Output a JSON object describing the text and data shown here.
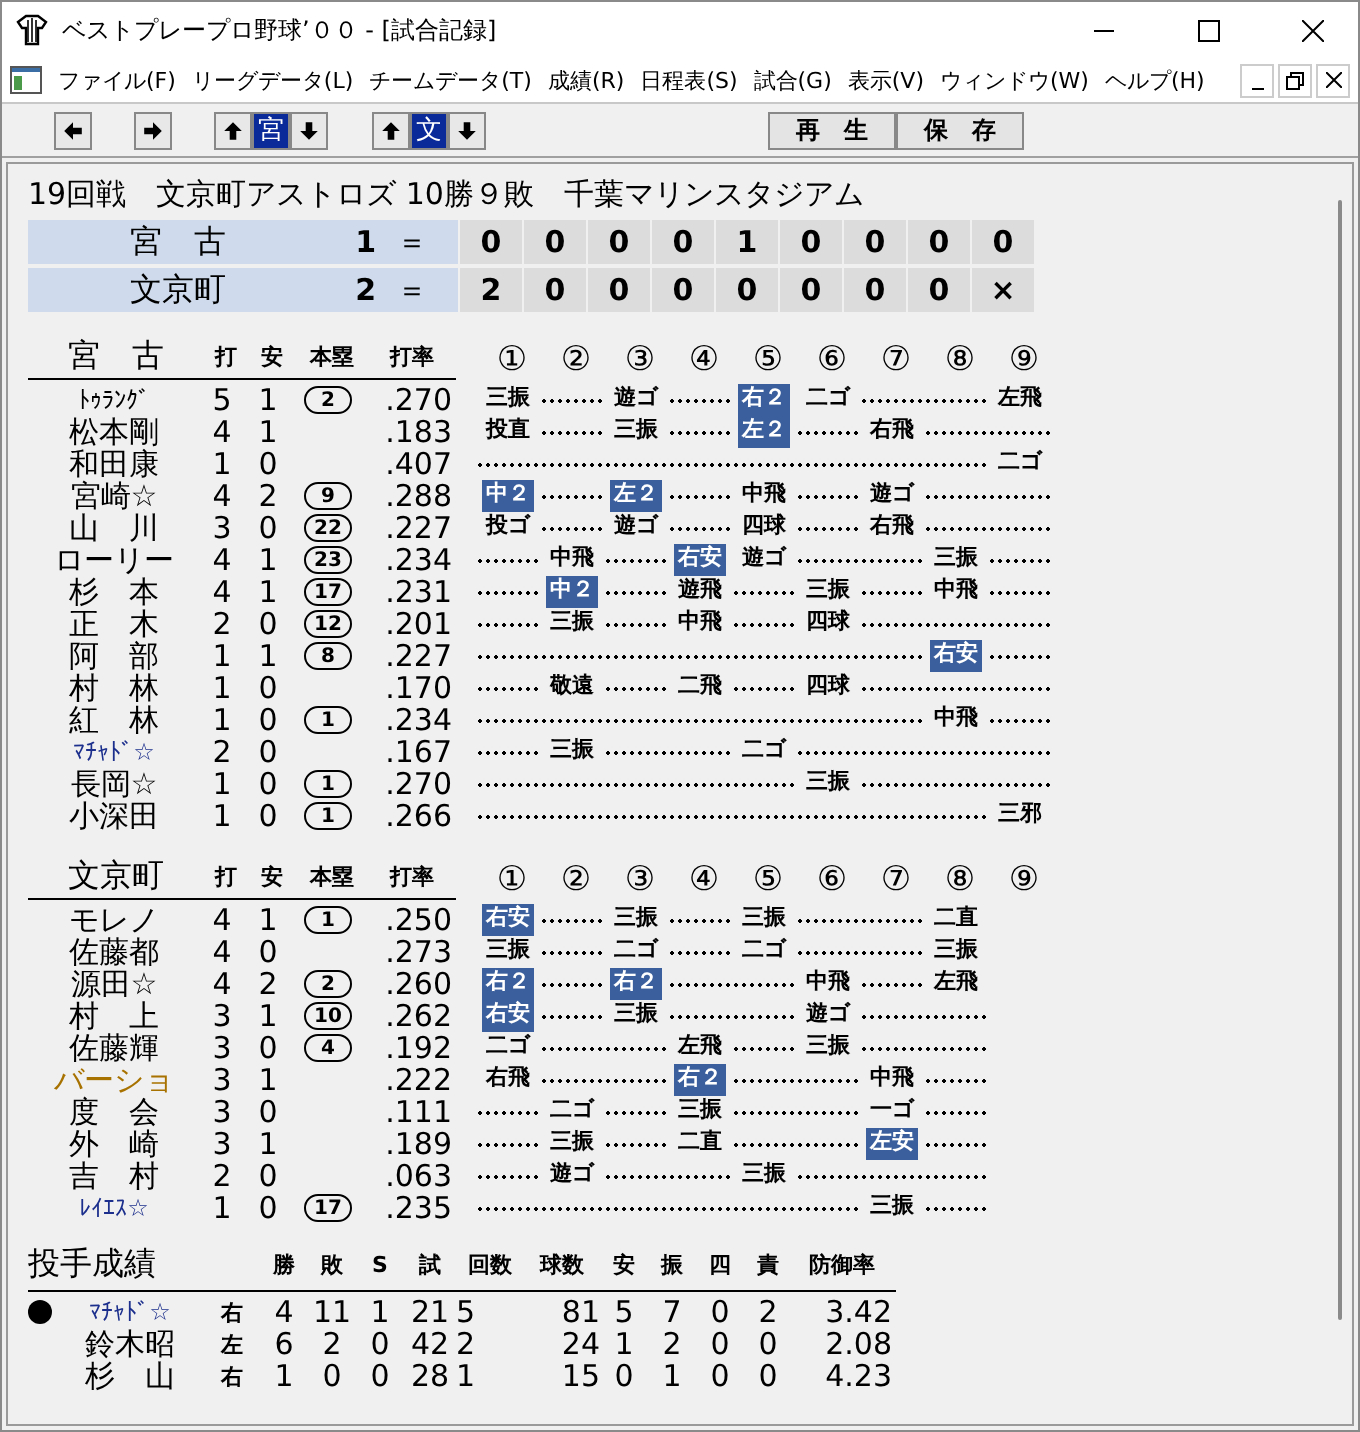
{
  "window": {
    "title": "ベストプレープロ野球’００ - [試合記録]"
  },
  "menu": [
    "ファイル(F)",
    "リーグデータ(L)",
    "チームデータ(T)",
    "成績(R)",
    "日程表(S)",
    "試合(G)",
    "表示(V)",
    "ウィンドウ(W)",
    "ヘルプ(H)"
  ],
  "toolbar": {
    "team_buttons": [
      {
        "label": "宮",
        "selected": true
      },
      {
        "label": "文",
        "selected": true
      }
    ],
    "actions": [
      "再　生",
      "保　存"
    ]
  },
  "game_info": "19回戦　文京町アストロズ 10勝９敗　千葉マリンスタジアム",
  "scoreboard": [
    {
      "team": "宮　古",
      "total": "1",
      "separator": "＝",
      "innings": [
        "0",
        "0",
        "0",
        "0",
        "1",
        "0",
        "0",
        "0",
        "0"
      ]
    },
    {
      "team": "文京町",
      "total": "2",
      "separator": "＝",
      "innings": [
        "2",
        "0",
        "0",
        "0",
        "0",
        "0",
        "0",
        "0",
        "×"
      ]
    }
  ],
  "batting": [
    {
      "team": "宮　古",
      "columns": [
        "打",
        "安",
        "本塁",
        "打率"
      ],
      "innings_headers": [
        "①",
        "②",
        "③",
        "④",
        "⑤",
        "⑥",
        "⑦",
        "⑧",
        "⑨"
      ],
      "rows": [
        {
          "name": "ﾄｩﾗﾝｸﾞ",
          "color": "#000000",
          "at_bats": "5",
          "hits": "1",
          "home_runs": "2",
          "average": ".270",
          "innings": [
            {
              "kind": "play",
              "result": "三振",
              "hit": false
            },
            {
              "kind": "empty"
            },
            {
              "kind": "play",
              "result": "遊ゴ",
              "hit": false
            },
            {
              "kind": "empty"
            },
            {
              "kind": "play",
              "result": "右２",
              "hit": true
            },
            {
              "kind": "play",
              "result": "二ゴ",
              "hit": false
            },
            {
              "kind": "empty"
            },
            {
              "kind": "empty"
            },
            {
              "kind": "play",
              "result": "左飛",
              "hit": false
            }
          ]
        },
        {
          "name": "松本剛",
          "color": "#000000",
          "at_bats": "4",
          "hits": "1",
          "average": ".183",
          "innings": [
            {
              "kind": "play",
              "result": "投直",
              "hit": false
            },
            {
              "kind": "empty"
            },
            {
              "kind": "play",
              "result": "三振",
              "hit": false
            },
            {
              "kind": "empty"
            },
            {
              "kind": "play",
              "result": "左２",
              "hit": true
            },
            {
              "kind": "empty"
            },
            {
              "kind": "play",
              "result": "右飛",
              "hit": false
            },
            {
              "kind": "empty"
            },
            {
              "kind": "empty"
            }
          ]
        },
        {
          "name": "和田康",
          "color": "#000000",
          "at_bats": "1",
          "hits": "0",
          "average": ".407",
          "innings": [
            {
              "kind": "empty"
            },
            {
              "kind": "empty"
            },
            {
              "kind": "empty"
            },
            {
              "kind": "empty"
            },
            {
              "kind": "empty"
            },
            {
              "kind": "empty"
            },
            {
              "kind": "empty"
            },
            {
              "kind": "empty"
            },
            {
              "kind": "play",
              "result": "二ゴ",
              "hit": false
            }
          ]
        },
        {
          "name": "宮崎☆",
          "color": "#000000",
          "at_bats": "4",
          "hits": "2",
          "home_runs": "9",
          "average": ".288",
          "innings": [
            {
              "kind": "play",
              "result": "中２",
              "hit": true
            },
            {
              "kind": "empty"
            },
            {
              "kind": "play",
              "result": "左２",
              "hit": true
            },
            {
              "kind": "empty"
            },
            {
              "kind": "play",
              "result": "中飛",
              "hit": false
            },
            {
              "kind": "empty"
            },
            {
              "kind": "play",
              "result": "遊ゴ",
              "hit": false
            },
            {
              "kind": "empty"
            },
            {
              "kind": "empty"
            }
          ]
        },
        {
          "name": "山　川",
          "color": "#000000",
          "at_bats": "3",
          "hits": "0",
          "home_runs": "22",
          "average": ".227",
          "innings": [
            {
              "kind": "play",
              "result": "投ゴ",
              "hit": false
            },
            {
              "kind": "empty"
            },
            {
              "kind": "play",
              "result": "遊ゴ",
              "hit": false
            },
            {
              "kind": "empty"
            },
            {
              "kind": "play",
              "result": "四球",
              "hit": false
            },
            {
              "kind": "empty"
            },
            {
              "kind": "play",
              "result": "右飛",
              "hit": false
            },
            {
              "kind": "empty"
            },
            {
              "kind": "empty"
            }
          ]
        },
        {
          "name": "ローリー",
          "color": "#000000",
          "at_bats": "4",
          "hits": "1",
          "home_runs": "23",
          "average": ".234",
          "innings": [
            {
              "kind": "empty"
            },
            {
              "kind": "play",
              "result": "中飛",
              "hit": false
            },
            {
              "kind": "empty"
            },
            {
              "kind": "play",
              "result": "右安",
              "hit": true
            },
            {
              "kind": "play",
              "result": "遊ゴ",
              "hit": false
            },
            {
              "kind": "empty"
            },
            {
              "kind": "empty"
            },
            {
              "kind": "play",
              "result": "三振",
              "hit": false
            },
            {
              "kind": "empty"
            }
          ]
        },
        {
          "name": "杉　本",
          "color": "#000000",
          "at_bats": "4",
          "hits": "1",
          "home_runs": "17",
          "average": ".231",
          "innings": [
            {
              "kind": "empty"
            },
            {
              "kind": "play",
              "result": "中２",
              "hit": true
            },
            {
              "kind": "empty"
            },
            {
              "kind": "play",
              "result": "遊飛",
              "hit": false
            },
            {
              "kind": "empty"
            },
            {
              "kind": "play",
              "result": "三振",
              "hit": false
            },
            {
              "kind": "empty"
            },
            {
              "kind": "play",
              "result": "中飛",
              "hit": false
            },
            {
              "kind": "empty"
            }
          ]
        },
        {
          "name": "正　木",
          "color": "#000000",
          "at_bats": "2",
          "hits": "0",
          "home_runs": "12",
          "average": ".201",
          "innings": [
            {
              "kind": "empty"
            },
            {
              "kind": "play",
              "result": "三振",
              "hit": false
            },
            {
              "kind": "empty"
            },
            {
              "kind": "play",
              "result": "中飛",
              "hit": false
            },
            {
              "kind": "empty"
            },
            {
              "kind": "play",
              "result": "四球",
              "hit": false
            },
            {
              "kind": "empty"
            },
            {
              "kind": "empty"
            },
            {
              "kind": "empty"
            }
          ]
        },
        {
          "name": "阿　部",
          "color": "#000000",
          "at_bats": "1",
          "hits": "1",
          "home_runs": "8",
          "average": ".227",
          "innings": [
            {
              "kind": "empty"
            },
            {
              "kind": "empty"
            },
            {
              "kind": "empty"
            },
            {
              "kind": "empty"
            },
            {
              "kind": "empty"
            },
            {
              "kind": "empty"
            },
            {
              "kind": "empty"
            },
            {
              "kind": "play",
              "result": "右安",
              "hit": true
            },
            {
              "kind": "empty"
            }
          ]
        },
        {
          "name": "村　林",
          "color": "#000000",
          "at_bats": "1",
          "hits": "0",
          "average": ".170",
          "innings": [
            {
              "kind": "empty"
            },
            {
              "kind": "play",
              "result": "敬遠",
              "hit": false
            },
            {
              "kind": "empty"
            },
            {
              "kind": "play",
              "result": "二飛",
              "hit": false
            },
            {
              "kind": "empty"
            },
            {
              "kind": "play",
              "result": "四球",
              "hit": false
            },
            {
              "kind": "empty"
            },
            {
              "kind": "empty"
            },
            {
              "kind": "empty"
            }
          ]
        },
        {
          "name": "紅　林",
          "color": "#000000",
          "at_bats": "1",
          "hits": "0",
          "home_runs": "1",
          "average": ".234",
          "innings": [
            {
              "kind": "empty"
            },
            {
              "kind": "empty"
            },
            {
              "kind": "empty"
            },
            {
              "kind": "empty"
            },
            {
              "kind": "empty"
            },
            {
              "kind": "empty"
            },
            {
              "kind": "empty"
            },
            {
              "kind": "play",
              "result": "中飛",
              "hit": false
            },
            {
              "kind": "empty"
            }
          ]
        },
        {
          "name": "ﾏﾁｬﾄﾞ☆",
          "color": "#1c2f8c",
          "at_bats": "2",
          "hits": "0",
          "average": ".167",
          "innings": [
            {
              "kind": "empty"
            },
            {
              "kind": "play",
              "result": "三振",
              "hit": false
            },
            {
              "kind": "empty"
            },
            {
              "kind": "empty"
            },
            {
              "kind": "play",
              "result": "二ゴ",
              "hit": false
            },
            {
              "kind": "empty"
            },
            {
              "kind": "empty"
            },
            {
              "kind": "empty"
            },
            {
              "kind": "empty"
            }
          ]
        },
        {
          "name": "長岡☆",
          "color": "#000000",
          "at_bats": "1",
          "hits": "0",
          "home_runs": "1",
          "average": ".270",
          "innings": [
            {
              "kind": "empty"
            },
            {
              "kind": "empty"
            },
            {
              "kind": "empty"
            },
            {
              "kind": "empty"
            },
            {
              "kind": "empty"
            },
            {
              "kind": "play",
              "result": "三振",
              "hit": false
            },
            {
              "kind": "empty"
            },
            {
              "kind": "empty"
            },
            {
              "kind": "empty"
            }
          ]
        },
        {
          "name": "小深田",
          "color": "#000000",
          "at_bats": "1",
          "hits": "0",
          "home_runs": "1",
          "average": ".266",
          "innings": [
            {
              "kind": "empty"
            },
            {
              "kind": "empty"
            },
            {
              "kind": "empty"
            },
            {
              "kind": "empty"
            },
            {
              "kind": "empty"
            },
            {
              "kind": "empty"
            },
            {
              "kind": "empty"
            },
            {
              "kind": "empty"
            },
            {
              "kind": "play",
              "result": "三邪",
              "hit": false
            }
          ]
        }
      ]
    },
    {
      "team": "文京町",
      "columns": [
        "打",
        "安",
        "本塁",
        "打率"
      ],
      "innings_headers": [
        "①",
        "②",
        "③",
        "④",
        "⑤",
        "⑥",
        "⑦",
        "⑧",
        "⑨"
      ],
      "rows": [
        {
          "name": "モレノ",
          "color": "#000000",
          "at_bats": "4",
          "hits": "1",
          "home_runs": "1",
          "average": ".250",
          "innings": [
            {
              "kind": "play",
              "result": "右安",
              "hit": true
            },
            {
              "kind": "empty"
            },
            {
              "kind": "play",
              "result": "三振",
              "hit": false
            },
            {
              "kind": "empty"
            },
            {
              "kind": "play",
              "result": "三振",
              "hit": false
            },
            {
              "kind": "empty"
            },
            {
              "kind": "empty"
            },
            {
              "kind": "play",
              "result": "二直",
              "hit": false
            }
          ]
        },
        {
          "name": "佐藤都",
          "color": "#000000",
          "at_bats": "4",
          "hits": "0",
          "average": ".273",
          "innings": [
            {
              "kind": "play",
              "result": "三振",
              "hit": false
            },
            {
              "kind": "empty"
            },
            {
              "kind": "play",
              "result": "二ゴ",
              "hit": false
            },
            {
              "kind": "empty"
            },
            {
              "kind": "play",
              "result": "二ゴ",
              "hit": false
            },
            {
              "kind": "empty"
            },
            {
              "kind": "empty"
            },
            {
              "kind": "play",
              "result": "三振",
              "hit": false
            }
          ]
        },
        {
          "name": "源田☆",
          "color": "#000000",
          "at_bats": "4",
          "hits": "2",
          "home_runs": "2",
          "average": ".260",
          "innings": [
            {
              "kind": "play",
              "result": "右２",
              "hit": true
            },
            {
              "kind": "empty"
            },
            {
              "kind": "play",
              "result": "右２",
              "hit": true
            },
            {
              "kind": "empty"
            },
            {
              "kind": "empty"
            },
            {
              "kind": "play",
              "result": "中飛",
              "hit": false
            },
            {
              "kind": "empty"
            },
            {
              "kind": "play",
              "result": "左飛",
              "hit": false
            }
          ]
        },
        {
          "name": "村　上",
          "color": "#000000",
          "at_bats": "3",
          "hits": "1",
          "home_runs": "10",
          "average": ".262",
          "innings": [
            {
              "kind": "play",
              "result": "右安",
              "hit": true
            },
            {
              "kind": "empty"
            },
            {
              "kind": "play",
              "result": "三振",
              "hit": false
            },
            {
              "kind": "empty"
            },
            {
              "kind": "empty"
            },
            {
              "kind": "play",
              "result": "遊ゴ",
              "hit": false
            },
            {
              "kind": "empty"
            },
            {
              "kind": "empty"
            }
          ]
        },
        {
          "name": "佐藤輝",
          "color": "#000000",
          "at_bats": "3",
          "hits": "0",
          "home_runs": "4",
          "average": ".192",
          "innings": [
            {
              "kind": "play",
              "result": "二ゴ",
              "hit": false
            },
            {
              "kind": "empty"
            },
            {
              "kind": "empty"
            },
            {
              "kind": "play",
              "result": "左飛",
              "hit": false
            },
            {
              "kind": "empty"
            },
            {
              "kind": "play",
              "result": "三振",
              "hit": false
            },
            {
              "kind": "empty"
            },
            {
              "kind": "empty"
            }
          ]
        },
        {
          "name": "バーショ",
          "color": "#a87200",
          "at_bats": "3",
          "hits": "1",
          "average": ".222",
          "innings": [
            {
              "kind": "play",
              "result": "右飛",
              "hit": false
            },
            {
              "kind": "empty"
            },
            {
              "kind": "empty"
            },
            {
              "kind": "play",
              "result": "右２",
              "hit": true
            },
            {
              "kind": "empty"
            },
            {
              "kind": "empty"
            },
            {
              "kind": "play",
              "result": "中飛",
              "hit": false
            },
            {
              "kind": "empty"
            }
          ]
        },
        {
          "name": "度　会",
          "color": "#000000",
          "at_bats": "3",
          "hits": "0",
          "average": ".111",
          "innings": [
            {
              "kind": "empty"
            },
            {
              "kind": "play",
              "result": "二ゴ",
              "hit": false
            },
            {
              "kind": "empty"
            },
            {
              "kind": "play",
              "result": "三振",
              "hit": false
            },
            {
              "kind": "empty"
            },
            {
              "kind": "empty"
            },
            {
              "kind": "play",
              "result": "一ゴ",
              "hit": false
            },
            {
              "kind": "empty"
            }
          ]
        },
        {
          "name": "外　崎",
          "color": "#000000",
          "at_bats": "3",
          "hits": "1",
          "average": ".189",
          "innings": [
            {
              "kind": "empty"
            },
            {
              "kind": "play",
              "result": "三振",
              "hit": false
            },
            {
              "kind": "empty"
            },
            {
              "kind": "play",
              "result": "二直",
              "hit": false
            },
            {
              "kind": "empty"
            },
            {
              "kind": "empty"
            },
            {
              "kind": "play",
              "result": "左安",
              "hit": true
            },
            {
              "kind": "empty"
            }
          ]
        },
        {
          "name": "吉　村",
          "color": "#000000",
          "at_bats": "2",
          "hits": "0",
          "average": ".063",
          "innings": [
            {
              "kind": "empty"
            },
            {
              "kind": "play",
              "result": "遊ゴ",
              "hit": false
            },
            {
              "kind": "empty"
            },
            {
              "kind": "empty"
            },
            {
              "kind": "play",
              "result": "三振",
              "hit": false
            },
            {
              "kind": "empty"
            },
            {
              "kind": "empty"
            },
            {
              "kind": "empty"
            }
          ]
        },
        {
          "name": "ﾚｲｴｽ☆",
          "color": "#1c2f8c",
          "at_bats": "1",
          "hits": "0",
          "home_runs": "17",
          "average": ".235",
          "innings": [
            {
              "kind": "empty"
            },
            {
              "kind": "empty"
            },
            {
              "kind": "empty"
            },
            {
              "kind": "empty"
            },
            {
              "kind": "empty"
            },
            {
              "kind": "empty"
            },
            {
              "kind": "play",
              "result": "三振",
              "hit": false
            },
            {
              "kind": "empty"
            }
          ]
        }
      ]
    }
  ],
  "pitching": {
    "title": "投手成績",
    "columns": [
      "勝",
      "敗",
      "S",
      "試",
      "回数",
      "球数",
      "安",
      "振",
      "四",
      "責",
      "防御率"
    ],
    "rows": [
      {
        "marked": true,
        "name": "ﾏﾁｬﾄﾞ☆",
        "color": "#1c2f8c",
        "hand": "右",
        "stats": [
          "4",
          "11",
          "1",
          "21",
          "5",
          "81",
          "5",
          "7",
          "0",
          "2",
          "3.42"
        ]
      },
      {
        "marked": false,
        "name": "鈴木昭",
        "color": "#000000",
        "hand": "左",
        "stats": [
          "6",
          "2",
          "0",
          "42",
          "2",
          "24",
          "1",
          "2",
          "0",
          "0",
          "2.08"
        ]
      },
      {
        "marked": false,
        "name": "杉　山",
        "color": "#000000",
        "hand": "右",
        "stats": [
          "1",
          "0",
          "0",
          "28",
          "1",
          "15",
          "0",
          "1",
          "0",
          "0",
          "4.23"
        ]
      }
    ]
  }
}
